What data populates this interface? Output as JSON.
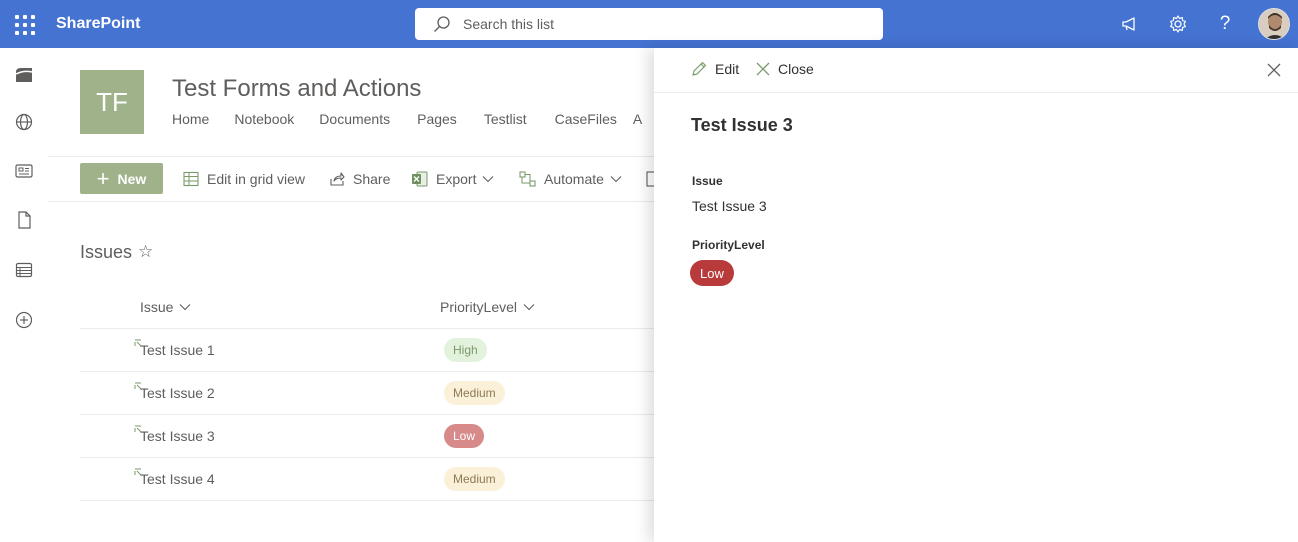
{
  "suite": {
    "app_name": "SharePoint",
    "search_placeholder": "Search this list"
  },
  "site": {
    "logo_initials": "TF",
    "title": "Test Forms and Actions",
    "nav": [
      "Home",
      "Notebook",
      "Documents",
      "Pages",
      "Testlist",
      "CaseFiles",
      "A"
    ]
  },
  "commands": {
    "new_label": "New",
    "edit_grid": "Edit in grid view",
    "share": "Share",
    "export": "Export",
    "automate": "Automate"
  },
  "list": {
    "title": "Issues",
    "columns": [
      "Issue",
      "PriorityLevel"
    ],
    "rows": [
      {
        "issue": "Test Issue 1",
        "priority": "High"
      },
      {
        "issue": "Test Issue 2",
        "priority": "Medium"
      },
      {
        "issue": "Test Issue 3",
        "priority": "Low"
      },
      {
        "issue": "Test Issue 4",
        "priority": "Medium"
      }
    ]
  },
  "priority_colors": {
    "High": {
      "bg": "#e3f2dc",
      "fg": "#7a9a6a"
    },
    "Medium": {
      "bg": "#fbf0d8",
      "fg": "#8c7a55"
    },
    "Low": {
      "bg": "#d68a8a",
      "fg": "#ffffff"
    }
  },
  "panel": {
    "edit_label": "Edit",
    "close_label": "Close",
    "title": "Test Issue 3",
    "fields": [
      {
        "label": "Issue",
        "value": "Test Issue 3"
      },
      {
        "label": "PriorityLevel",
        "value": "Low"
      }
    ]
  },
  "colors": {
    "suite_bar": "#4573d2",
    "accent": "#9fb28a",
    "low_pill": "#b83a3a"
  }
}
